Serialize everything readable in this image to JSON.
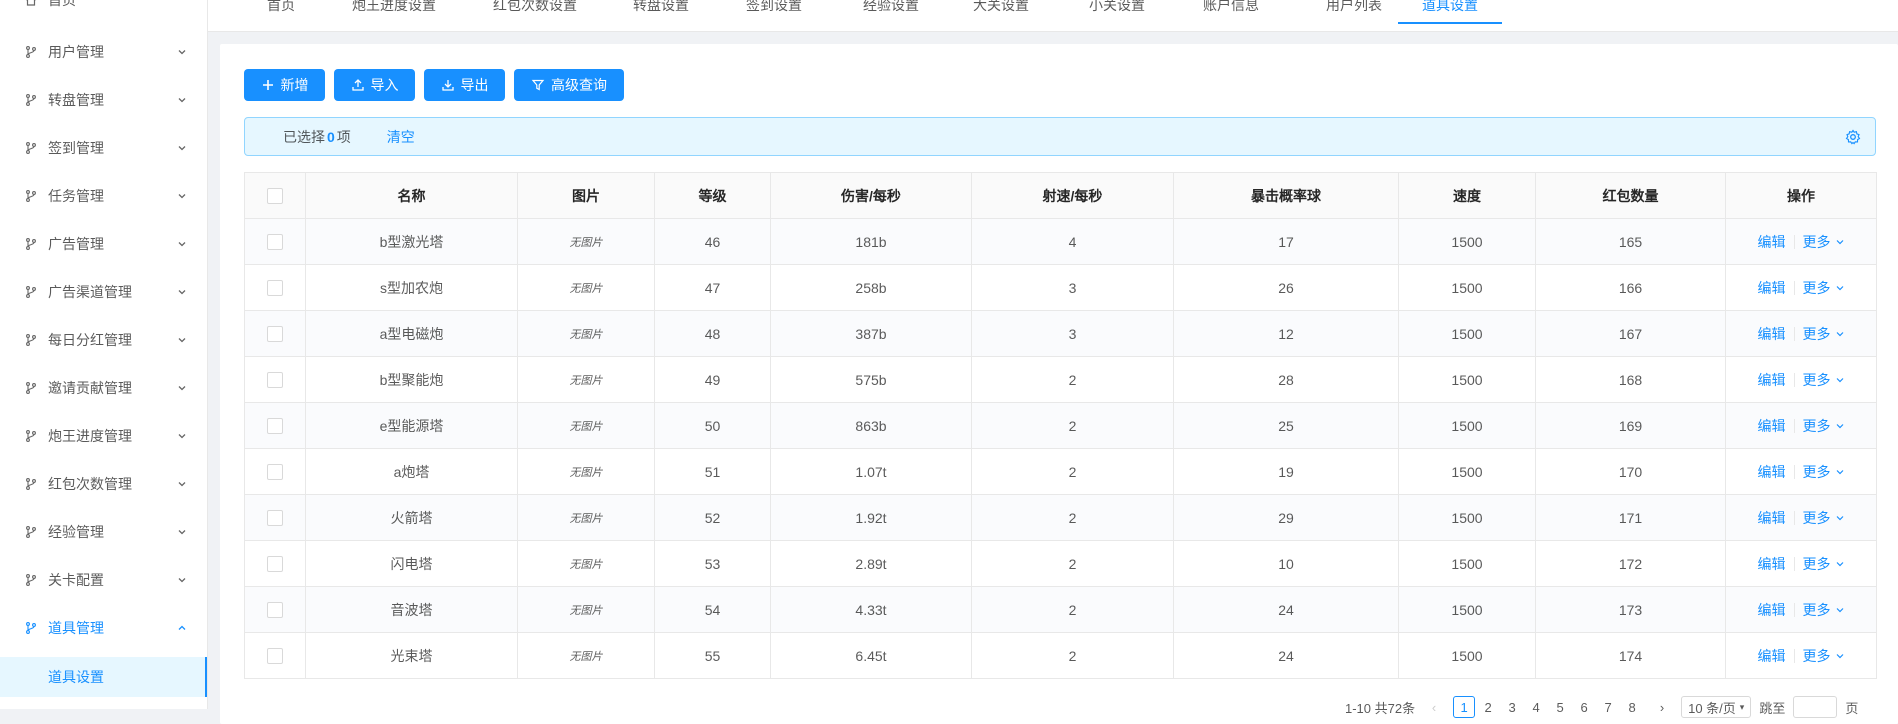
{
  "sidebar": {
    "home": "首页",
    "items": [
      {
        "label": "用户管理"
      },
      {
        "label": "转盘管理"
      },
      {
        "label": "签到管理"
      },
      {
        "label": "任务管理"
      },
      {
        "label": "广告管理"
      },
      {
        "label": "广告渠道管理"
      },
      {
        "label": "每日分红管理"
      },
      {
        "label": "邀请贡献管理"
      },
      {
        "label": "炮王进度管理"
      },
      {
        "label": "红包次数管理"
      },
      {
        "label": "经验管理"
      },
      {
        "label": "关卡配置"
      },
      {
        "label": "道具管理"
      }
    ],
    "active_sub": "道具设置"
  },
  "tabs": [
    "首页",
    "炮王进度设置",
    "红包次数设置",
    "转盘设置",
    "签到设置",
    "经验设置",
    "大关设置",
    "小关设置",
    "账户信息",
    "用户列表",
    "道具设置"
  ],
  "active_tab": "道具设置",
  "toolbar": {
    "add": "新增",
    "import": "导入",
    "export": "导出",
    "advanced": "高级查询"
  },
  "selection": {
    "prefix": "已选择",
    "count": "0",
    "suffix": "项",
    "clear": "清空"
  },
  "table": {
    "columns": [
      "名称",
      "图片",
      "等级",
      "伤害/每秒",
      "射速/每秒",
      "暴击概率球",
      "速度",
      "红包数量",
      "操作"
    ],
    "rows": [
      {
        "name": "b型激光塔",
        "image": "无图片",
        "level": "46",
        "damage": "181b",
        "rate": "4",
        "crit": "17",
        "speed": "1500",
        "redpack": "165"
      },
      {
        "name": "s型加农炮",
        "image": "无图片",
        "level": "47",
        "damage": "258b",
        "rate": "3",
        "crit": "26",
        "speed": "1500",
        "redpack": "166"
      },
      {
        "name": "a型电磁炮",
        "image": "无图片",
        "level": "48",
        "damage": "387b",
        "rate": "3",
        "crit": "12",
        "speed": "1500",
        "redpack": "167"
      },
      {
        "name": "b型聚能炮",
        "image": "无图片",
        "level": "49",
        "damage": "575b",
        "rate": "2",
        "crit": "28",
        "speed": "1500",
        "redpack": "168"
      },
      {
        "name": "e型能源塔",
        "image": "无图片",
        "level": "50",
        "damage": "863b",
        "rate": "2",
        "crit": "25",
        "speed": "1500",
        "redpack": "169"
      },
      {
        "name": "a炮塔",
        "image": "无图片",
        "level": "51",
        "damage": "1.07t",
        "rate": "2",
        "crit": "19",
        "speed": "1500",
        "redpack": "170"
      },
      {
        "name": "火箭塔",
        "image": "无图片",
        "level": "52",
        "damage": "1.92t",
        "rate": "2",
        "crit": "29",
        "speed": "1500",
        "redpack": "171"
      },
      {
        "name": "闪电塔",
        "image": "无图片",
        "level": "53",
        "damage": "2.89t",
        "rate": "2",
        "crit": "10",
        "speed": "1500",
        "redpack": "172"
      },
      {
        "name": "音波塔",
        "image": "无图片",
        "level": "54",
        "damage": "4.33t",
        "rate": "2",
        "crit": "24",
        "speed": "1500",
        "redpack": "173"
      },
      {
        "name": "光束塔",
        "image": "无图片",
        "level": "55",
        "damage": "6.45t",
        "rate": "2",
        "crit": "24",
        "speed": "1500",
        "redpack": "174"
      }
    ],
    "edit": "编辑",
    "more": "更多"
  },
  "pagination": {
    "total": "1-10 共72条",
    "pages": [
      "1",
      "2",
      "3",
      "4",
      "5",
      "6",
      "7",
      "8"
    ],
    "current": "1",
    "page_size": "10 条/页",
    "jump_label": "跳至",
    "page_unit": "页"
  },
  "colors": {
    "primary": "#1890ff",
    "alert_bg": "#e6f7ff"
  }
}
